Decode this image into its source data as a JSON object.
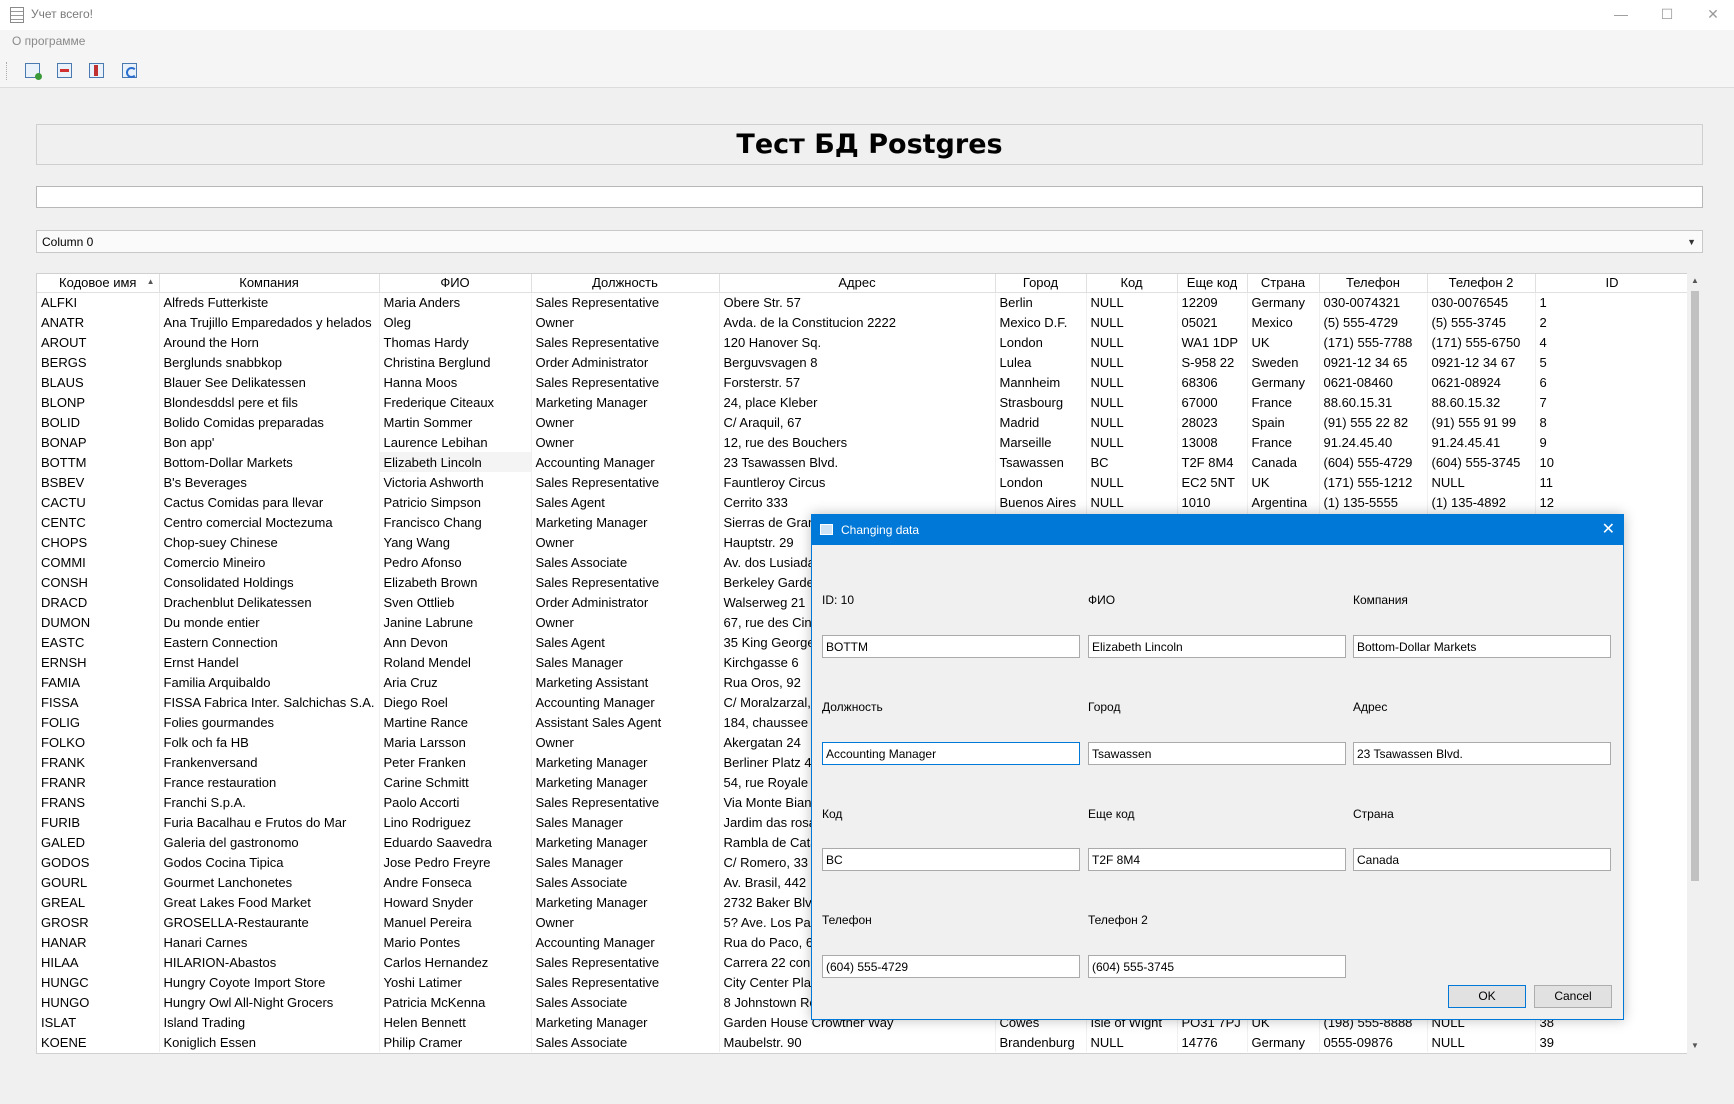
{
  "window": {
    "title": "Учет всего!",
    "minimize": "—",
    "maximize": "☐",
    "close": "✕"
  },
  "menu": {
    "about": "О программе"
  },
  "toolbar": {
    "icons": [
      "add-record-icon",
      "delete-record-icon",
      "edit-record-icon",
      "refresh-icon"
    ]
  },
  "heading": "Тест БД Postgres",
  "search": {
    "value": ""
  },
  "column_select": {
    "value": "Column 0"
  },
  "table": {
    "columns": [
      "Кодовое имя",
      "Компания",
      "ФИО",
      "Должность",
      "Адрес",
      "Город",
      "Код",
      "Еще код",
      "Страна",
      "Телефон",
      "Телефон 2",
      "ID"
    ],
    "rows": [
      [
        "ALFKI",
        "Alfreds Futterkiste",
        "Maria Anders",
        "Sales Representative",
        "Obere Str. 57",
        "Berlin",
        "NULL",
        "12209",
        "Germany",
        "030-0074321",
        "030-0076545",
        "1"
      ],
      [
        "ANATR",
        "Ana Trujillo Emparedados y helados",
        "Oleg",
        "Owner",
        "Avda. de la Constitucion 2222",
        "Mexico D.F.",
        "NULL",
        "05021",
        "Mexico",
        "(5) 555-4729",
        "(5) 555-3745",
        "2"
      ],
      [
        "AROUT",
        "Around the Horn",
        "Thomas Hardy",
        "Sales Representative",
        "120 Hanover Sq.",
        "London",
        "NULL",
        "WA1 1DP",
        "UK",
        "(171) 555-7788",
        "(171) 555-6750",
        "4"
      ],
      [
        "BERGS",
        "Berglunds snabbkop",
        "Christina Berglund",
        "Order Administrator",
        "Berguvsvagen  8",
        "Lulea",
        "NULL",
        "S-958 22",
        "Sweden",
        "0921-12 34 65",
        "0921-12 34 67",
        "5"
      ],
      [
        "BLAUS",
        "Blauer See Delikatessen",
        "Hanna Moos",
        "Sales Representative",
        "Forsterstr. 57",
        "Mannheim",
        "NULL",
        "68306",
        "Germany",
        "0621-08460",
        "0621-08924",
        "6"
      ],
      [
        "BLONP",
        "Blondesddsl pere et fils",
        "Frederique Citeaux",
        "Marketing Manager",
        "24, place Kleber",
        "Strasbourg",
        "NULL",
        "67000",
        "France",
        "88.60.15.31",
        "88.60.15.32",
        "7"
      ],
      [
        "BOLID",
        "Bolido Comidas preparadas",
        "Martin Sommer",
        "Owner",
        "C/ Araquil, 67",
        "Madrid",
        "NULL",
        "28023",
        "Spain",
        "(91) 555 22 82",
        "(91) 555 91 99",
        "8"
      ],
      [
        "BONAP",
        "Bon app'",
        "Laurence Lebihan",
        "Owner",
        "12, rue des Bouchers",
        "Marseille",
        "NULL",
        "13008",
        "France",
        "91.24.45.40",
        "91.24.45.41",
        "9"
      ],
      [
        "BOTTM",
        "Bottom-Dollar Markets",
        "Elizabeth Lincoln",
        "Accounting Manager",
        "23 Tsawassen Blvd.",
        "Tsawassen",
        "BC",
        "T2F 8M4",
        "Canada",
        "(604) 555-4729",
        "(604) 555-3745",
        "10"
      ],
      [
        "BSBEV",
        "B's Beverages",
        "Victoria Ashworth",
        "Sales Representative",
        "Fauntleroy Circus",
        "London",
        "NULL",
        "EC2 5NT",
        "UK",
        "(171) 555-1212",
        "NULL",
        "11"
      ],
      [
        "CACTU",
        "Cactus Comidas para llevar",
        "Patricio Simpson",
        "Sales Agent",
        "Cerrito 333",
        "Buenos Aires",
        "NULL",
        "1010",
        "Argentina",
        "(1) 135-5555",
        "(1) 135-4892",
        "12"
      ],
      [
        "CENTC",
        "Centro comercial Moctezuma",
        "Francisco Chang",
        "Marketing Manager",
        "Sierras de Granada 9993",
        "",
        "",
        "",
        "",
        "",
        "",
        ""
      ],
      [
        "CHOPS",
        "Chop-suey Chinese",
        "Yang Wang",
        "Owner",
        "Hauptstr. 29",
        "",
        "",
        "",
        "",
        "",
        "",
        ""
      ],
      [
        "COMMI",
        "Comercio Mineiro",
        "Pedro Afonso",
        "Sales Associate",
        "Av. dos Lusiadas, 23",
        "",
        "",
        "",
        "",
        "",
        "",
        ""
      ],
      [
        "CONSH",
        "Consolidated Holdings",
        "Elizabeth Brown",
        "Sales Representative",
        "Berkeley Gardens",
        "",
        "",
        "",
        "",
        "",
        "",
        ""
      ],
      [
        "DRACD",
        "Drachenblut Delikatessen",
        "Sven Ottlieb",
        "Order Administrator",
        "Walserweg 21",
        "",
        "",
        "",
        "",
        "",
        "",
        ""
      ],
      [
        "DUMON",
        "Du monde entier",
        "Janine Labrune",
        "Owner",
        "67, rue des Cinquante Otages",
        "",
        "",
        "",
        "",
        "",
        "",
        ""
      ],
      [
        "EASTC",
        "Eastern Connection",
        "Ann Devon",
        "Sales Agent",
        "35 King George",
        "",
        "",
        "",
        "",
        "",
        "",
        ""
      ],
      [
        "ERNSH",
        "Ernst Handel",
        "Roland Mendel",
        "Sales Manager",
        "Kirchgasse 6",
        "",
        "",
        "",
        "",
        "",
        "",
        ""
      ],
      [
        "FAMIA",
        "Familia Arquibaldo",
        "Aria Cruz",
        "Marketing Assistant",
        "Rua Oros, 92",
        "",
        "",
        "",
        "",
        "",
        "",
        ""
      ],
      [
        "FISSA",
        "FISSA Fabrica Inter. Salchichas S.A.",
        "Diego Roel",
        "Accounting Manager",
        "C/ Moralzarzal, 86",
        "",
        "",
        "",
        "",
        "",
        "",
        ""
      ],
      [
        "FOLIG",
        "Folies gourmandes",
        "Martine Rance",
        "Assistant Sales Agent",
        "184, chaussee de Tournai",
        "",
        "",
        "",
        "",
        "",
        "",
        ""
      ],
      [
        "FOLKO",
        "Folk och fa HB",
        "Maria Larsson",
        "Owner",
        "Akergatan 24",
        "",
        "",
        "",
        "",
        "",
        "",
        ""
      ],
      [
        "FRANK",
        "Frankenversand",
        "Peter Franken",
        "Marketing Manager",
        "Berliner Platz 43",
        "",
        "",
        "",
        "",
        "",
        "",
        ""
      ],
      [
        "FRANR",
        "France restauration",
        "Carine Schmitt",
        "Marketing Manager",
        "54, rue Royale",
        "",
        "",
        "",
        "",
        "",
        "",
        ""
      ],
      [
        "FRANS",
        "Franchi S.p.A.",
        "Paolo Accorti",
        "Sales Representative",
        "Via Monte Bianco 34",
        "",
        "",
        "",
        "",
        "",
        "",
        ""
      ],
      [
        "FURIB",
        "Furia Bacalhau e Frutos do Mar",
        "Lino Rodriguez",
        "Sales Manager",
        "Jardim das rosas n. 32",
        "",
        "",
        "",
        "",
        "",
        "",
        ""
      ],
      [
        "GALED",
        "Galeria del gastronomo",
        "Eduardo Saavedra",
        "Marketing Manager",
        "Rambla de Cataluna, 23",
        "",
        "",
        "",
        "",
        "",
        "",
        ""
      ],
      [
        "GODOS",
        "Godos Cocina Tipica",
        "Jose Pedro Freyre",
        "Sales Manager",
        "C/ Romero, 33",
        "",
        "",
        "",
        "",
        "",
        "",
        ""
      ],
      [
        "GOURL",
        "Gourmet Lanchonetes",
        "Andre Fonseca",
        "Sales Associate",
        "Av. Brasil, 442",
        "",
        "",
        "",
        "",
        "",
        "",
        ""
      ],
      [
        "GREAL",
        "Great Lakes Food Market",
        "Howard Snyder",
        "Marketing Manager",
        "2732 Baker Blvd.",
        "",
        "",
        "",
        "",
        "",
        "",
        ""
      ],
      [
        "GROSR",
        "GROSELLA-Restaurante",
        "Manuel Pereira",
        "Owner",
        "5? Ave. Los Palos Grandes",
        "",
        "",
        "",
        "",
        "",
        "",
        ""
      ],
      [
        "HANAR",
        "Hanari Carnes",
        "Mario Pontes",
        "Accounting Manager",
        "Rua do Paco, 67",
        "",
        "",
        "",
        "",
        "",
        "",
        ""
      ],
      [
        "HILAA",
        "HILARION-Abastos",
        "Carlos Hernandez",
        "Sales Representative",
        "Carrera 22 con Ave.",
        "",
        "",
        "",
        "",
        "",
        "",
        ""
      ],
      [
        "HUNGC",
        "Hungry Coyote Import Store",
        "Yoshi Latimer",
        "Sales Representative",
        "City Center Plaza",
        "",
        "",
        "",
        "",
        "",
        "",
        ""
      ],
      [
        "HUNGO",
        "Hungry Owl All-Night Grocers",
        "Patricia McKenna",
        "Sales Associate",
        "8 Johnstown Road",
        "",
        "",
        "",
        "",
        "",
        "",
        ""
      ],
      [
        "ISLAT",
        "Island Trading",
        "Helen Bennett",
        "Marketing Manager",
        "Garden House Crowther Way",
        "Cowes",
        "Isle of Wight",
        "PO31 7PJ",
        "UK",
        "(198) 555-8888",
        "NULL",
        "38"
      ],
      [
        "KOENE",
        "Koniglich Essen",
        "Philip Cramer",
        "Sales Associate",
        "Maubelstr. 90",
        "Brandenburg",
        "NULL",
        "14776",
        "Germany",
        "0555-09876",
        "NULL",
        "39"
      ]
    ]
  },
  "dialog": {
    "title": "Changing data",
    "close": "✕",
    "labels": {
      "id": "ID: 10",
      "fio": "ФИО",
      "company": "Компания",
      "position": "Должность",
      "city": "Город",
      "address": "Адрес",
      "code": "Код",
      "code2": "Еще код",
      "country": "Страна",
      "phone": "Телефон",
      "phone2": "Телефон 2"
    },
    "fields": {
      "codename": "BOTTM",
      "fio": "Elizabeth Lincoln",
      "company": "Bottom-Dollar Markets",
      "position": "Accounting Manager",
      "city": "Tsawassen",
      "address": "23 Tsawassen Blvd.",
      "code": "BC",
      "code2": "T2F 8M4",
      "country": "Canada",
      "phone": "(604) 555-4729",
      "phone2": "(604) 555-3745"
    },
    "ok": "OK",
    "cancel": "Cancel"
  }
}
